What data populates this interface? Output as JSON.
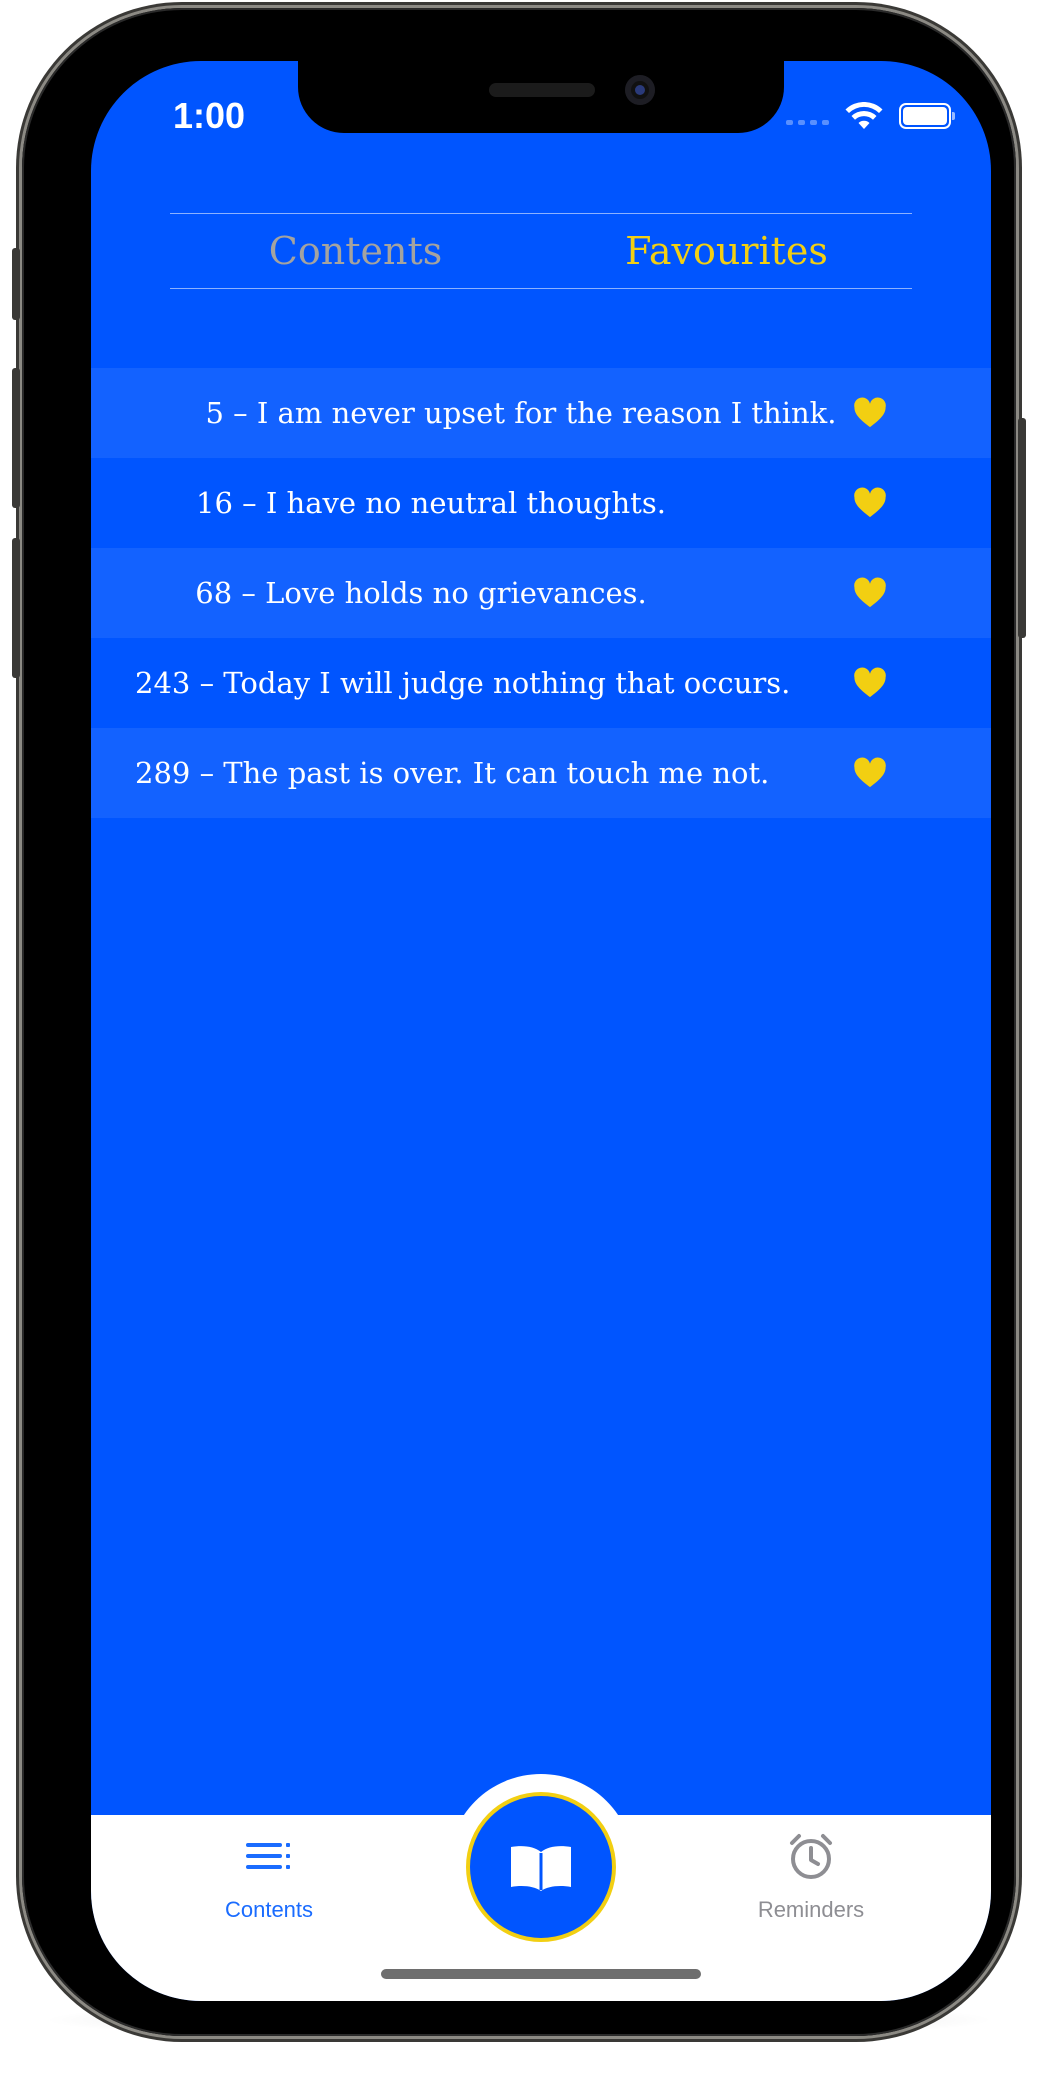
{
  "status_bar": {
    "time": "1:00"
  },
  "segmented_control": {
    "tabs": [
      {
        "label": "Contents",
        "selected": false
      },
      {
        "label": "Favourites",
        "selected": true
      }
    ]
  },
  "favourites": [
    {
      "text": "5 – I am never upset for the reason I think.",
      "favourite": true
    },
    {
      "text": "16 – I have no neutral thoughts.",
      "favourite": true
    },
    {
      "text": "68 – Love holds no grievances.",
      "favourite": true
    },
    {
      "text": "243 – Today I will judge nothing that occurs.",
      "favourite": true
    },
    {
      "text": "289 – The past is over. It can touch me not.",
      "favourite": true
    }
  ],
  "tab_bar": {
    "contents_label": "Contents",
    "reminders_label": "Reminders",
    "center_icon": "open-book-icon"
  },
  "colors": {
    "background": "#0055ff",
    "row_alt": "#1362ff",
    "accent_yellow": "#f2cf12",
    "inactive_gray": "#a4a3a0",
    "tab_active": "#1a6cff",
    "tab_inactive": "#8e8e93"
  }
}
